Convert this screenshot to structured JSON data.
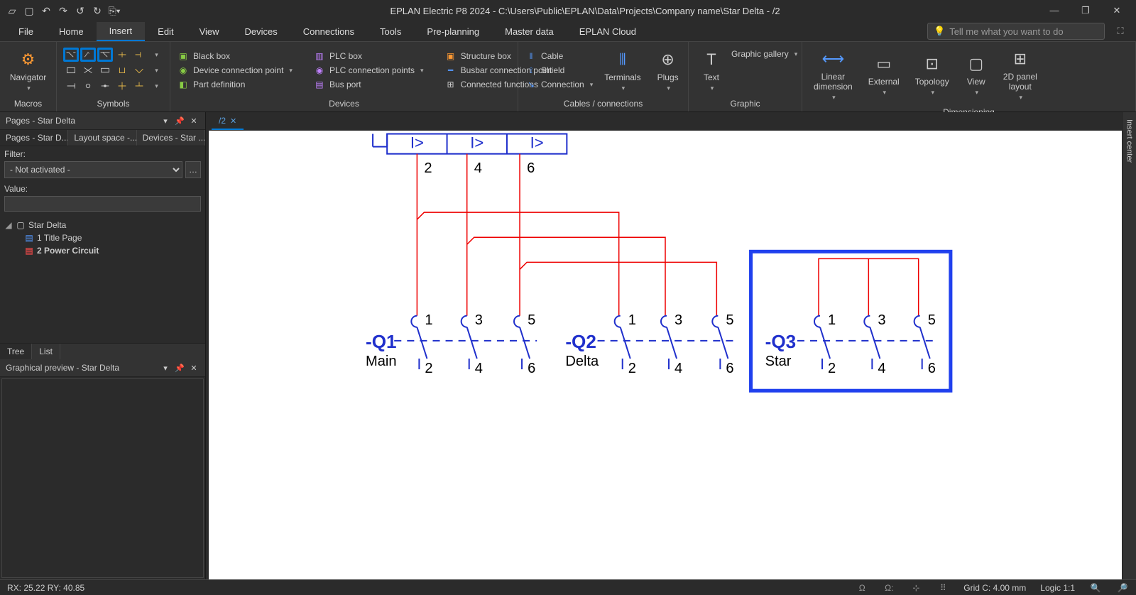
{
  "title": "EPLAN Electric P8 2024 - C:\\Users\\Public\\EPLAN\\Data\\Projects\\Company name\\Star Delta - /2",
  "menu": {
    "file": "File",
    "home": "Home",
    "insert": "Insert",
    "edit": "Edit",
    "view": "View",
    "devices": "Devices",
    "connections": "Connections",
    "tools": "Tools",
    "preplan": "Pre-planning",
    "master": "Master data",
    "cloud": "EPLAN Cloud"
  },
  "search_placeholder": "Tell me what you want to do",
  "ribbon": {
    "macros": {
      "navigator": "Navigator",
      "label": "Macros"
    },
    "symbols": {
      "label": "Symbols"
    },
    "devices": {
      "label": "Devices",
      "blackbox": "Black box",
      "devconn": "Device connection point",
      "partdef": "Part definition",
      "plcbox": "PLC box",
      "plcconn": "PLC connection points",
      "busport": "Bus port",
      "structbox": "Structure box",
      "busbar": "Busbar connection point",
      "connfn": "Connected functions"
    },
    "cables": {
      "label": "Cables / connections",
      "cable": "Cable",
      "shield": "Shield",
      "connection": "Connection",
      "terminals": "Terminals",
      "plugs": "Plugs"
    },
    "graphic": {
      "label": "Graphic",
      "text": "Text",
      "gallery": "Graphic gallery"
    },
    "dim": {
      "label": "Dimensioning",
      "linear": "Linear\ndimension",
      "external": "External",
      "topology": "Topology",
      "view": "View",
      "panel": "2D panel\nlayout"
    }
  },
  "pages_panel": {
    "title": "Pages - Star Delta",
    "tabs": {
      "pages": "Pages - Star D...",
      "layout": "Layout space -...",
      "devices": "Devices - Star ..."
    },
    "filter_label": "Filter:",
    "filter_value": "- Not activated -",
    "value_label": "Value:",
    "tree": {
      "root": "Star Delta",
      "p1": "1 Title Page",
      "p2": "2 Power Circuit"
    },
    "tree_tab": "Tree",
    "list_tab": "List"
  },
  "preview": {
    "title": "Graphical preview - Star Delta"
  },
  "doc_tab": "/2",
  "right_rail": "Insert center",
  "schematic": {
    "relays": [
      "I>",
      "I>",
      "I>"
    ],
    "top_pins": [
      "2",
      "4",
      "6"
    ],
    "contacts": {
      "top": [
        "1",
        "3",
        "5"
      ],
      "bottom": [
        "2",
        "4",
        "6"
      ]
    },
    "q1": {
      "tag": "-Q1",
      "name": "Main"
    },
    "q2": {
      "tag": "-Q2",
      "name": "Delta"
    },
    "q3": {
      "tag": "-Q3",
      "name": "Star"
    }
  },
  "status": {
    "coord": "RX: 25.22 RY: 40.85",
    "grid": "Grid C: 4.00 mm",
    "logic": "Logic 1:1"
  }
}
